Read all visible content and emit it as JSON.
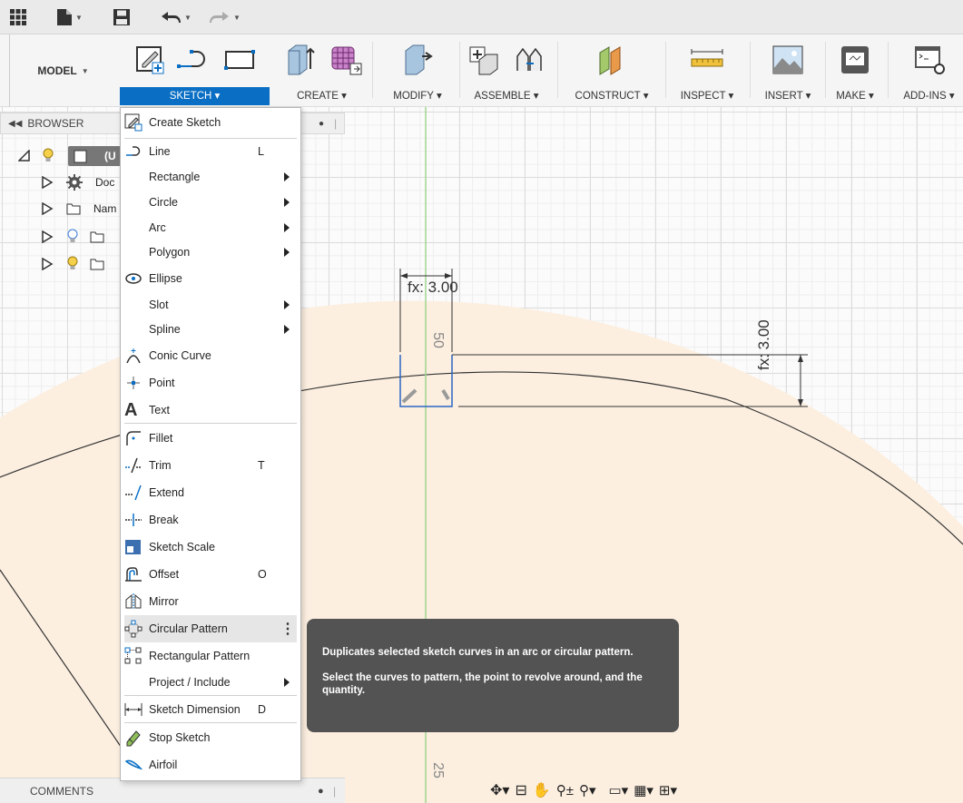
{
  "toolbar": {
    "workspace": "MODEL",
    "groups": {
      "sketch": "SKETCH",
      "create": "CREATE",
      "modify": "MODIFY",
      "assemble": "ASSEMBLE",
      "construct": "CONSTRUCT",
      "inspect": "INSPECT",
      "insert": "INSERT",
      "make": "MAKE",
      "addins": "ADD-INS"
    }
  },
  "browser": {
    "title": "BROWSER",
    "root_label": "(U",
    "items": [
      "Doc",
      "Nam",
      "",
      ""
    ]
  },
  "comments": {
    "title": "COMMENTS"
  },
  "menu": {
    "items": [
      {
        "label": "Create Sketch",
        "icon": "create-sketch-icon",
        "key": ""
      },
      {
        "label": "Line",
        "icon": "line-icon",
        "key": "L"
      },
      {
        "label": "Rectangle",
        "icon": "",
        "key": ""
      },
      {
        "label": "Circle",
        "icon": "",
        "key": ""
      },
      {
        "label": "Arc",
        "icon": "",
        "key": ""
      },
      {
        "label": "Polygon",
        "icon": "",
        "key": ""
      },
      {
        "label": "Ellipse",
        "icon": "ellipse-icon",
        "key": ""
      },
      {
        "label": "Slot",
        "icon": "",
        "key": ""
      },
      {
        "label": "Spline",
        "icon": "",
        "key": ""
      },
      {
        "label": "Conic Curve",
        "icon": "conic-curve-icon",
        "key": ""
      },
      {
        "label": "Point",
        "icon": "point-icon",
        "key": ""
      },
      {
        "label": "Text",
        "icon": "text-icon",
        "key": ""
      },
      {
        "label": "Fillet",
        "icon": "fillet-icon",
        "key": ""
      },
      {
        "label": "Trim",
        "icon": "trim-icon",
        "key": "T"
      },
      {
        "label": "Extend",
        "icon": "extend-icon",
        "key": ""
      },
      {
        "label": "Break",
        "icon": "break-icon",
        "key": ""
      },
      {
        "label": "Sketch Scale",
        "icon": "sketch-scale-icon",
        "key": ""
      },
      {
        "label": "Offset",
        "icon": "offset-icon",
        "key": "O"
      },
      {
        "label": "Mirror",
        "icon": "mirror-icon",
        "key": ""
      },
      {
        "label": "Circular Pattern",
        "icon": "circular-pattern-icon",
        "key": ""
      },
      {
        "label": "Rectangular Pattern",
        "icon": "rectangular-pattern-icon",
        "key": ""
      },
      {
        "label": "Project / Include",
        "icon": "",
        "key": ""
      },
      {
        "label": "Sketch Dimension",
        "icon": "sketch-dimension-icon",
        "key": "D"
      },
      {
        "label": "Stop Sketch",
        "icon": "stop-sketch-icon",
        "key": ""
      },
      {
        "label": "Airfoil",
        "icon": "airfoil-icon",
        "key": ""
      }
    ]
  },
  "tooltip": {
    "line1": "Duplicates selected sketch curves in an arc or circular pattern.",
    "line2": "Select the curves to pattern, the point to revolve around, and the quantity."
  },
  "sketch": {
    "dim_width": "fx: 3.00",
    "dim_height": "fx: 3.00",
    "ruler_top": "50",
    "ruler_bottom": "25"
  },
  "colors": {
    "accent": "#0a6fc4",
    "profile_fill": "#fcefe0",
    "axis_green": "#9fd68f"
  }
}
